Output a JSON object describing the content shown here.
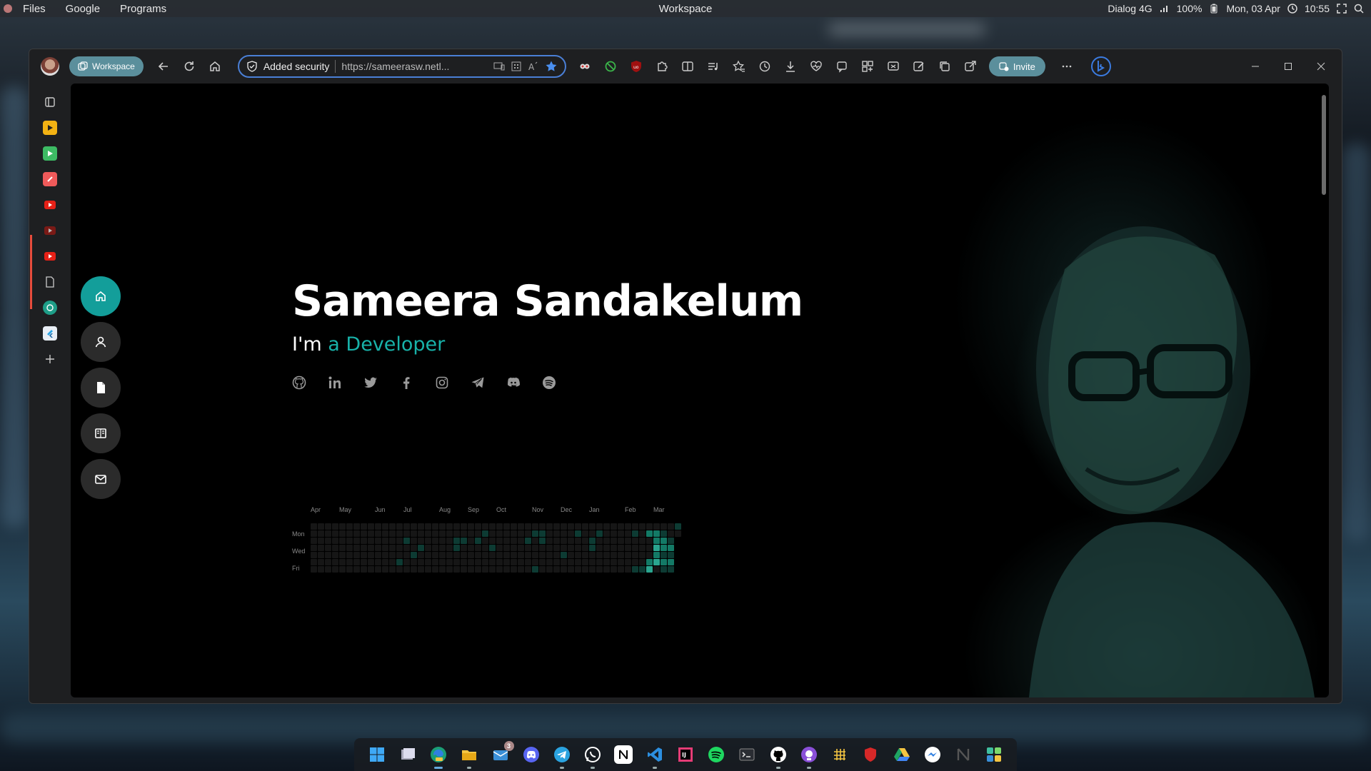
{
  "os_bar": {
    "menus": [
      "Files",
      "Google",
      "Programs"
    ],
    "title": "Workspace",
    "network": "Dialog 4G",
    "battery": "100%",
    "date": "Mon, 03 Apr",
    "time": "10:55"
  },
  "browser": {
    "workspace_label": "Workspace",
    "security_label": "Added security",
    "url": "https://sameerasw.netl...",
    "invite_label": "Invite"
  },
  "page": {
    "name": "Sameera Sandakelum",
    "tagline_prefix": "I'm",
    "tagline_accent": "a Developer",
    "accent_color": "#18b2a9",
    "nav": [
      "home-icon",
      "user-icon",
      "file-icon",
      "book-icon",
      "mail-icon"
    ],
    "socials": [
      "github-icon",
      "linkedin-icon",
      "twitter-icon",
      "facebook-icon",
      "instagram-icon",
      "telegram-icon",
      "discord-icon",
      "spotify-icon"
    ]
  },
  "contributions": {
    "months": [
      "Apr",
      "May",
      "Jun",
      "Jul",
      "Aug",
      "Sep",
      "Oct",
      "Nov",
      "Dec",
      "Jan",
      "Feb",
      "Mar"
    ],
    "days": [
      "Mon",
      "Wed",
      "Fri"
    ],
    "weeks": 52,
    "colors": [
      "#161616",
      "#0e4429",
      "#006d32",
      "#26a641",
      "#39d353"
    ],
    "active": [
      [
        13,
        2,
        1
      ],
      [
        20,
        2,
        1
      ],
      [
        20,
        3,
        1
      ],
      [
        21,
        2,
        1
      ],
      [
        14,
        4,
        1
      ],
      [
        12,
        5,
        1
      ],
      [
        15,
        3,
        1
      ],
      [
        24,
        1,
        1
      ],
      [
        25,
        3,
        1
      ],
      [
        23,
        2,
        1
      ],
      [
        31,
        1,
        1
      ],
      [
        31,
        6,
        1
      ],
      [
        32,
        7,
        1
      ],
      [
        33,
        7,
        1
      ],
      [
        32,
        1,
        1
      ],
      [
        32,
        2,
        1
      ],
      [
        30,
        2,
        1
      ],
      [
        35,
        4,
        1
      ],
      [
        37,
        1,
        1
      ],
      [
        39,
        3,
        1
      ],
      [
        39,
        2,
        1
      ],
      [
        40,
        1,
        1
      ],
      [
        45,
        1,
        1
      ],
      [
        45,
        7,
        1
      ],
      [
        46,
        7,
        1
      ],
      [
        47,
        7,
        2
      ],
      [
        47,
        1,
        2
      ],
      [
        48,
        1,
        2
      ],
      [
        48,
        2,
        2
      ],
      [
        49,
        1,
        1
      ],
      [
        49,
        2,
        2
      ],
      [
        49,
        3,
        2
      ],
      [
        49,
        4,
        1
      ],
      [
        49,
        5,
        2
      ],
      [
        49,
        6,
        1
      ],
      [
        50,
        2,
        1
      ],
      [
        50,
        3,
        2
      ],
      [
        50,
        4,
        1
      ],
      [
        50,
        5,
        2
      ],
      [
        50,
        6,
        1
      ],
      [
        51,
        0,
        1
      ],
      [
        48,
        3,
        3
      ],
      [
        48,
        5,
        3
      ],
      [
        48,
        4,
        2
      ],
      [
        47,
        6,
        3
      ],
      [
        48,
        7,
        2
      ],
      [
        47,
        5,
        2
      ],
      [
        49,
        7,
        3
      ],
      [
        50,
        7,
        1
      ],
      [
        46,
        6,
        1
      ],
      [
        45,
        6,
        1
      ],
      [
        44,
        7,
        1
      ],
      [
        47,
        8,
        1
      ]
    ]
  },
  "taskbar": [
    "windows-icon",
    "files-icon",
    "edge-icon",
    "explorer-icon",
    "mail-icon",
    "discord-icon",
    "telegram-icon",
    "whatsapp-icon",
    "notion-icon",
    "vscode-icon",
    "jetbrains-icon",
    "spotify-icon",
    "terminal-icon",
    "github-icon",
    "github-desktop-icon",
    "grid-icon",
    "shield-icon",
    "drive-icon",
    "messenger-icon",
    "notion-n-icon",
    "tiles-icon"
  ],
  "mail_badge": "3"
}
